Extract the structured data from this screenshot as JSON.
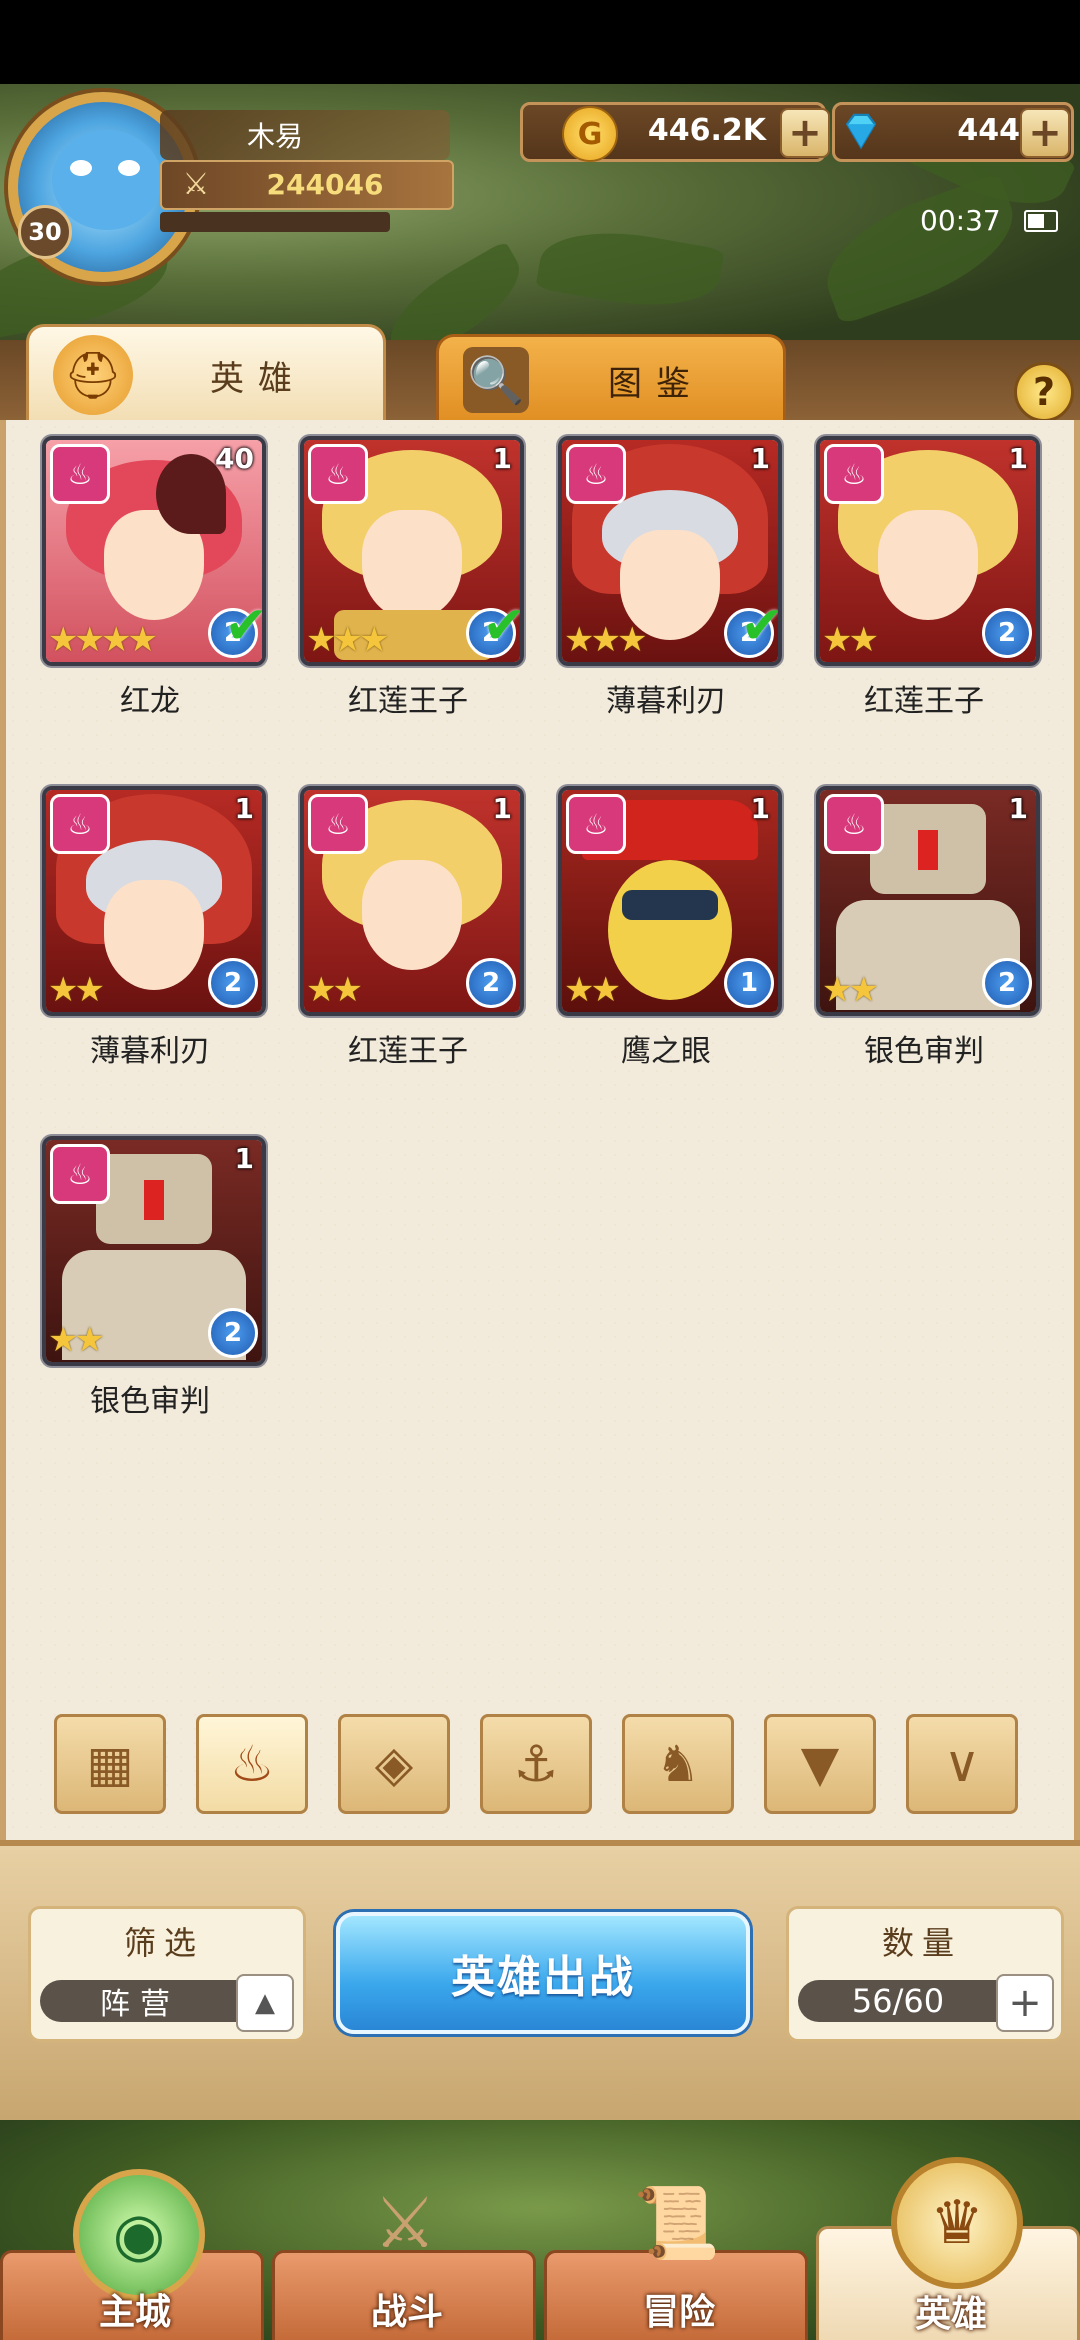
{
  "player": {
    "name": "木易",
    "level": "30",
    "power": "244046"
  },
  "currency": {
    "gold": "446.2K",
    "gems": "444"
  },
  "status": {
    "time": "00:37"
  },
  "tabs": [
    {
      "label": "英雄"
    },
    {
      "label": "图鉴"
    }
  ],
  "heroes": [
    {
      "name": "红龙",
      "level": "40",
      "stars": "★★★★",
      "rank": "2",
      "deployed": true
    },
    {
      "name": "红莲王子",
      "level": "1",
      "stars": "★★★",
      "rank": "2",
      "deployed": true
    },
    {
      "name": "薄暮利刃",
      "level": "1",
      "stars": "★★★",
      "rank": "2",
      "deployed": true
    },
    {
      "name": "红莲王子",
      "level": "1",
      "stars": "★★",
      "rank": "2",
      "deployed": false
    },
    {
      "name": "薄暮利刃",
      "level": "1",
      "stars": "★★",
      "rank": "2",
      "deployed": false
    },
    {
      "name": "红莲王子",
      "level": "1",
      "stars": "★★",
      "rank": "2",
      "deployed": false
    },
    {
      "name": "鹰之眼",
      "level": "1",
      "stars": "★★",
      "rank": "1",
      "deployed": false
    },
    {
      "name": "银色审判",
      "level": "1",
      "stars": "★★",
      "rank": "2",
      "deployed": false
    },
    {
      "name": "银色审判",
      "level": "1",
      "stars": "★★",
      "rank": "2",
      "deployed": false
    }
  ],
  "filter": {
    "title": "筛选",
    "value": "阵营"
  },
  "deploy_button": "英雄出战",
  "count": {
    "title": "数量",
    "value": "56/60"
  },
  "nav": [
    {
      "label": "主城"
    },
    {
      "label": "战斗"
    },
    {
      "label": "冒险"
    },
    {
      "label": "英雄"
    }
  ],
  "colors": {
    "faction": "#d8397a",
    "deploy": "#3aa7ec",
    "gold": "#f6dc7a"
  }
}
